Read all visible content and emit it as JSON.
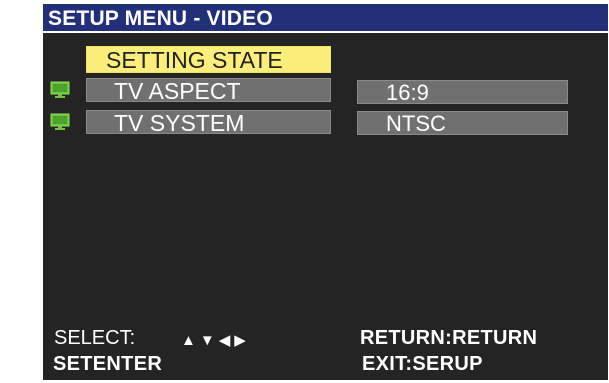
{
  "title": "SETUP MENU - VIDEO",
  "setting_state_label": "SETTING STATE",
  "rows": [
    {
      "label": "TV ASPECT",
      "value": "16:9",
      "icon": "monitor-icon"
    },
    {
      "label": "TV SYSTEM",
      "value": "NTSC",
      "icon": "monitor-icon"
    }
  ],
  "footer": {
    "select_label": "SELECT:",
    "nav_arrows": "▲▼◀▶",
    "setenter": "SETENTER",
    "return_hint": "RETURN:RETURN",
    "exit_hint": "EXIT:SERUP"
  },
  "colors": {
    "title_bar": "#22307a",
    "panel": "#242424",
    "highlight": "#fbee7a",
    "field": "#707070",
    "icon": "#6cc33f"
  }
}
